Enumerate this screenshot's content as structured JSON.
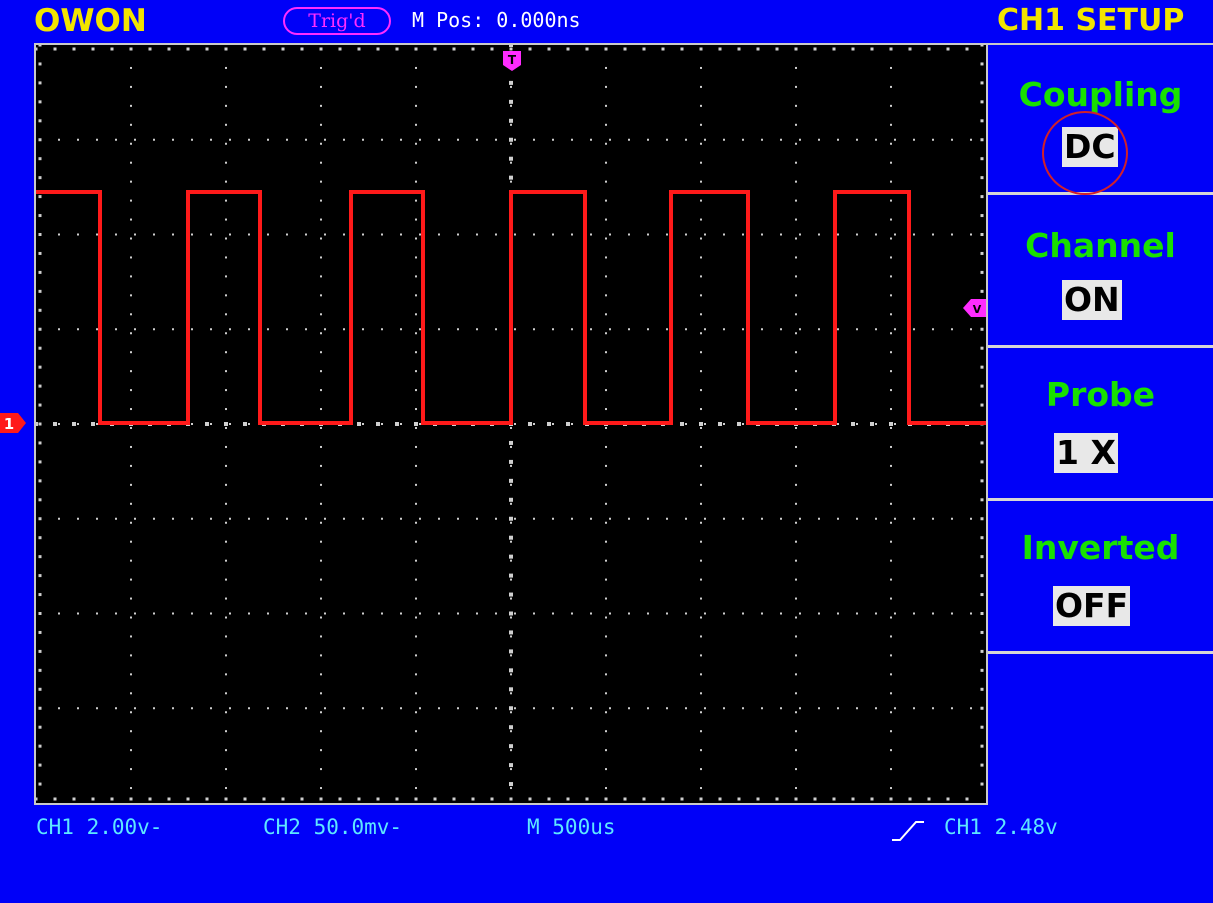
{
  "header": {
    "brand": "OWON",
    "trigger_status": "Trig'd",
    "m_pos": "M Pos: 0.000ns",
    "panel_title": "CH1 SETUP"
  },
  "markers": {
    "trigger_position": "T",
    "trigger_level": "V",
    "channel": "1"
  },
  "menu": [
    {
      "label": "Coupling",
      "value": "DC",
      "highlighted": true
    },
    {
      "label": "Channel",
      "value": "ON"
    },
    {
      "label": "Probe",
      "value": "1 X"
    },
    {
      "label": "Inverted",
      "value": "OFF"
    }
  ],
  "status": {
    "ch1": "CH1 2.00v-",
    "ch2": "CH2 50.0mv-",
    "timebase": "M 500us",
    "trigger": "CH1 2.48v"
  },
  "colors": {
    "background": "#0000f8",
    "trace": "#ff1a1a",
    "menu_label": "#18e000",
    "accent": "#f2e400",
    "marker": "#ff2cff",
    "status": "#5ee7ff"
  },
  "waveform": {
    "shape": "square",
    "cycles": 6,
    "duty": 0.55
  }
}
